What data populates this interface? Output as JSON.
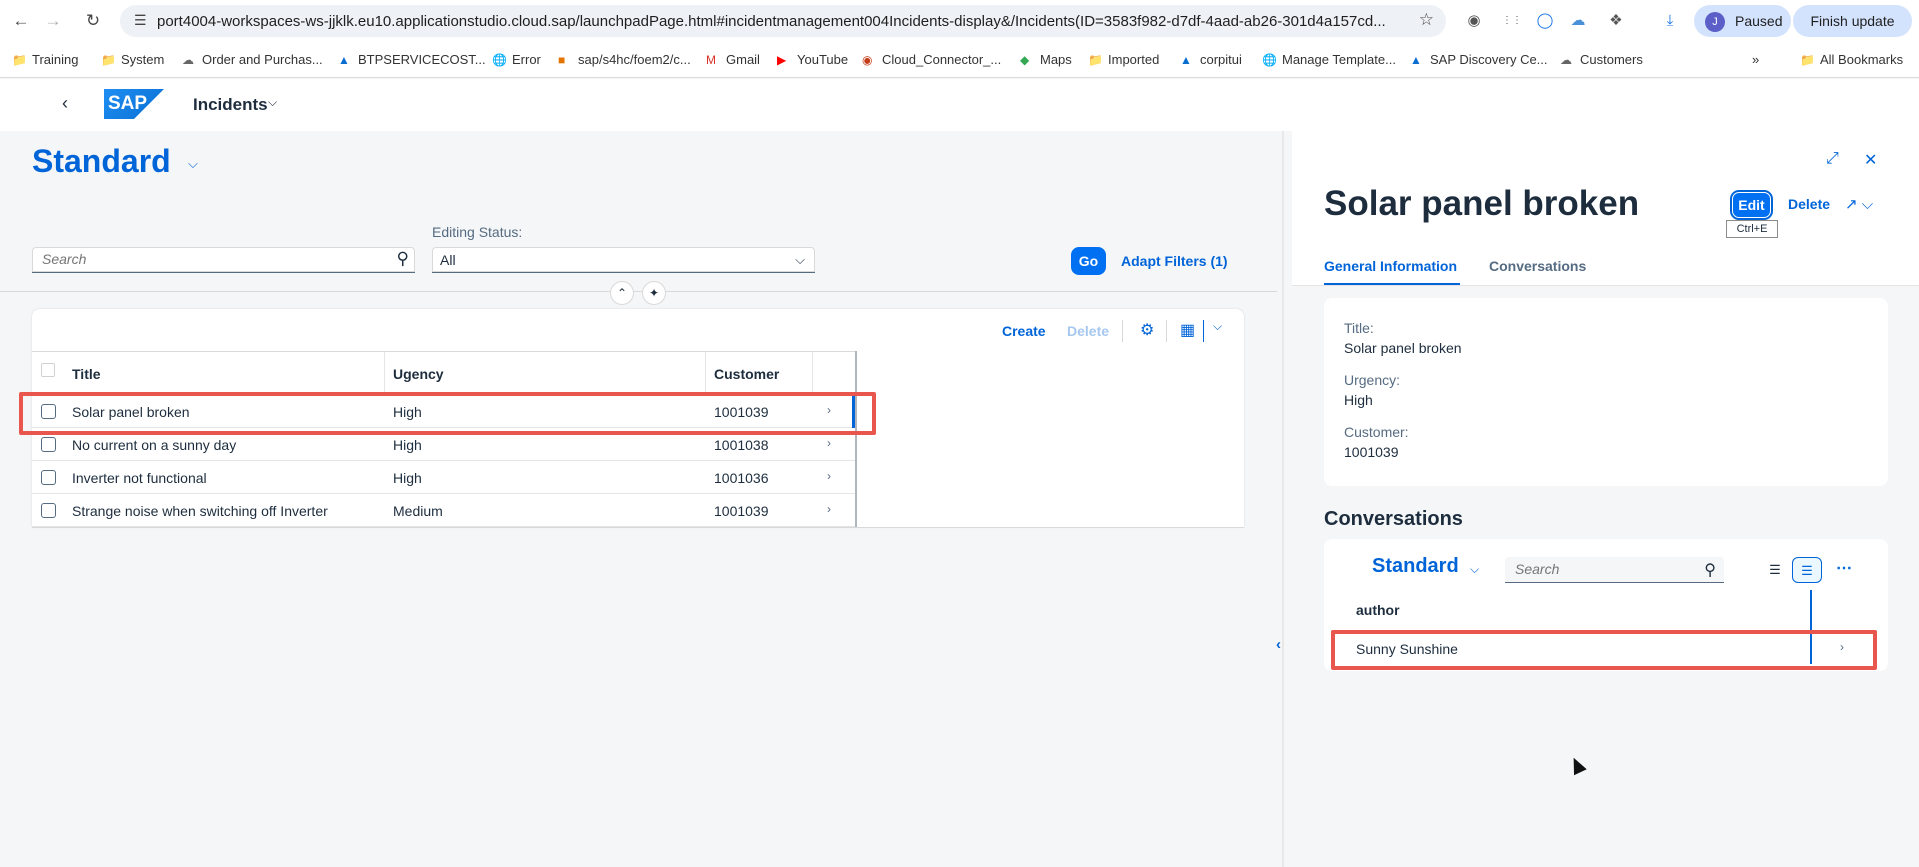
{
  "browser": {
    "url": "port4004-workspaces-ws-jjklk.eu10.applicationstudio.cloud.sap/launchpadPage.html#incidentmanagement004Incidents-display&/Incidents(ID=3583f982-d7df-4aad-ab26-301d4a157cd...",
    "profile_initial": "J",
    "profile_status": "Paused",
    "finish_update_label": "Finish update",
    "bookmarks": [
      {
        "label": "Training",
        "icon": "folder-icon"
      },
      {
        "label": "System",
        "icon": "folder-icon"
      },
      {
        "label": "Order and Purchas...",
        "icon": "cloud-icon"
      },
      {
        "label": "BTPSERVICECOST...",
        "icon": "sap-icon"
      },
      {
        "label": "Error",
        "icon": "globe-icon"
      },
      {
        "label": "sap/s4hc/foem2/c...",
        "icon": "page-icon"
      },
      {
        "label": "Gmail",
        "icon": "gmail-icon"
      },
      {
        "label": "YouTube",
        "icon": "youtube-icon"
      },
      {
        "label": "Cloud_Connector_...",
        "icon": "ppt-icon"
      },
      {
        "label": "Maps",
        "icon": "maps-icon"
      },
      {
        "label": "Imported",
        "icon": "folder-icon"
      },
      {
        "label": "corpitui",
        "icon": "sap-icon"
      },
      {
        "label": "Manage Template...",
        "icon": "globe-icon"
      },
      {
        "label": "SAP Discovery Ce...",
        "icon": "sap-icon"
      },
      {
        "label": "Customers",
        "icon": "cloud-icon"
      }
    ],
    "all_bookmarks_label": "All Bookmarks"
  },
  "shell": {
    "logo_text": "SAP",
    "app_title": "Incidents"
  },
  "list_report": {
    "variant": "Standard",
    "search_placeholder": "Search",
    "editing_status_label": "Editing Status:",
    "editing_status_value": "All",
    "go_label": "Go",
    "adapt_filters_label": "Adapt Filters (1)",
    "toolbar": {
      "create_label": "Create",
      "delete_label": "Delete"
    },
    "columns": [
      "Title",
      "Ugency",
      "Customer"
    ],
    "rows": [
      {
        "title": "Solar panel broken",
        "urgency": "High",
        "customer": "1001039"
      },
      {
        "title": "No current on a sunny day",
        "urgency": "High",
        "customer": "1001038"
      },
      {
        "title": "Inverter not functional",
        "urgency": "High",
        "customer": "1001036"
      },
      {
        "title": "Strange noise when switching off Inverter",
        "urgency": "Medium",
        "customer": "1001039"
      }
    ]
  },
  "object_page": {
    "title": "Solar panel broken",
    "edit_label": "Edit",
    "edit_shortcut": "Ctrl+E",
    "delete_label": "Delete",
    "tabs": [
      "General Information",
      "Conversations"
    ],
    "general_info": {
      "title_label": "Title:",
      "title_value": "Solar panel broken",
      "urgency_label": "Urgency:",
      "urgency_value": "High",
      "customer_label": "Customer:",
      "customer_value": "1001039"
    },
    "conversations": {
      "section_title": "Conversations",
      "variant": "Standard",
      "search_placeholder": "Search",
      "column_author": "author",
      "rows": [
        {
          "author": "Sunny Sunshine"
        }
      ]
    }
  },
  "colors": {
    "accent": "#0064d9",
    "emphasized_button": "#0070f2",
    "highlight_box": "#e8564e"
  }
}
